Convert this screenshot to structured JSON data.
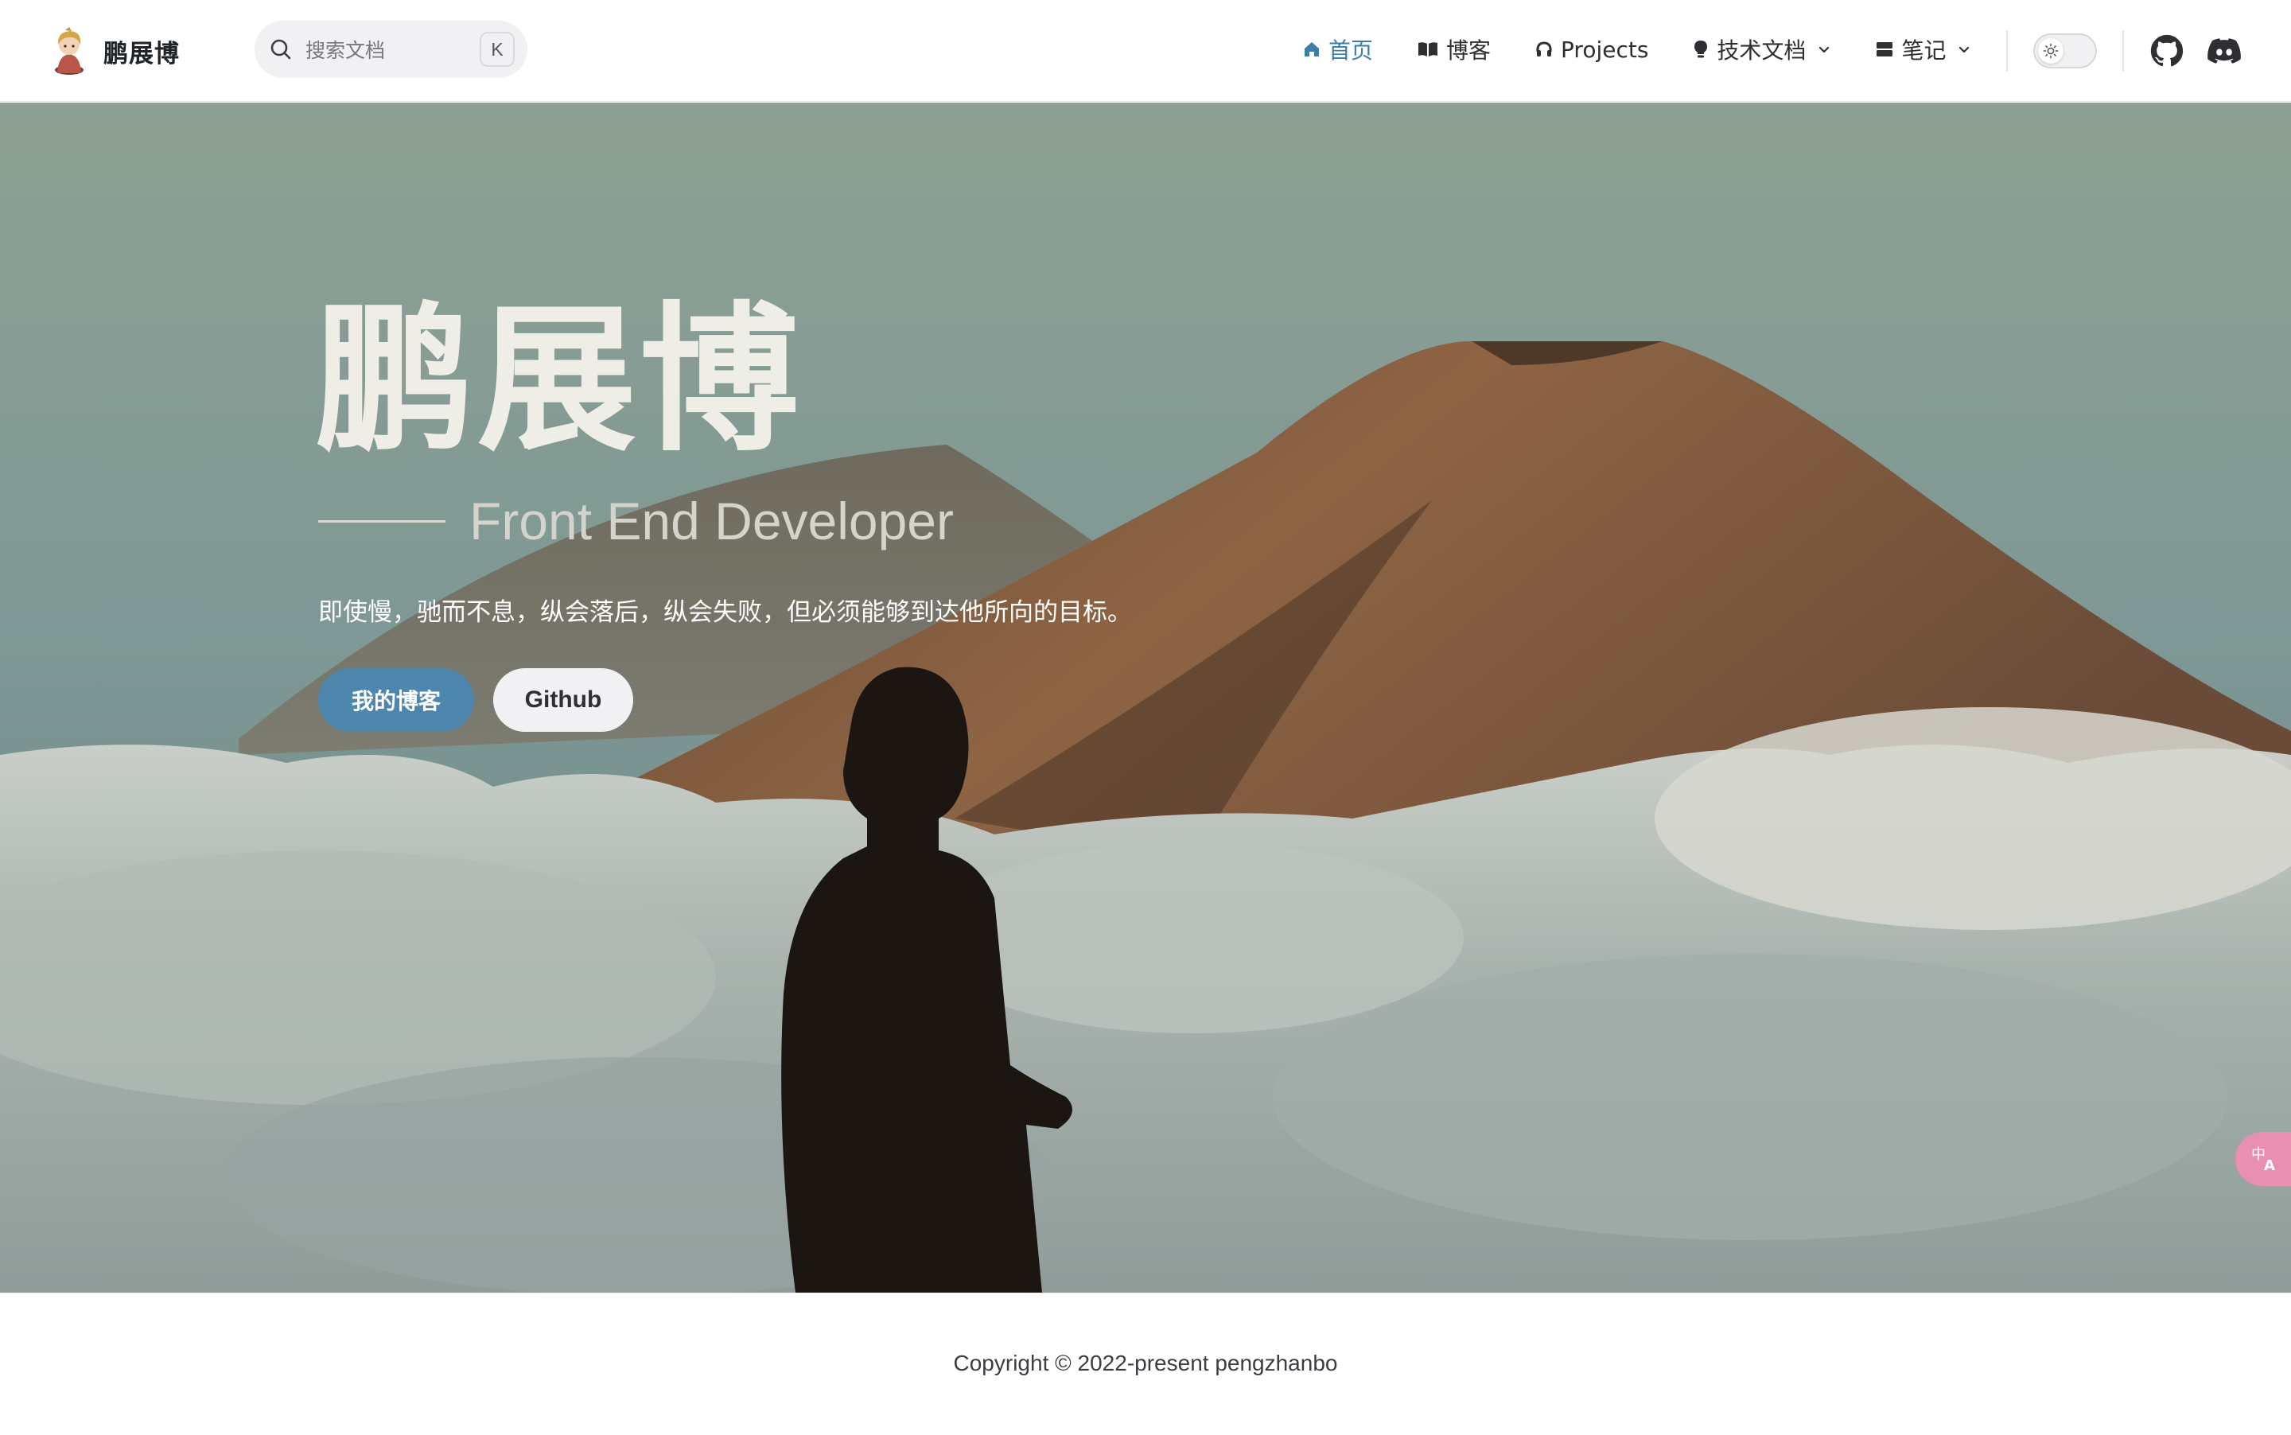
{
  "navbar": {
    "brand_title": "鹏展博",
    "search": {
      "placeholder": "搜索文档",
      "shortcut_key": "K"
    },
    "links": [
      {
        "label": "首页",
        "icon": "home-icon",
        "active": true
      },
      {
        "label": "博客",
        "icon": "book-open-icon",
        "active": false
      },
      {
        "label": "Projects",
        "icon": "headphones-icon",
        "active": false
      },
      {
        "label": "技术文档",
        "icon": "lightbulb-icon",
        "active": false,
        "dropdown": true
      },
      {
        "label": "笔记",
        "icon": "server-icon",
        "active": false,
        "dropdown": true
      }
    ],
    "social": [
      "github-icon",
      "discord-icon"
    ]
  },
  "hero": {
    "name": "鹏展博",
    "role": "Front End Developer",
    "motto": "即使慢，驰而不息，纵会落后，纵会失败，但必须能够到达他所向的目标。",
    "primary_button": "我的博客",
    "secondary_button": "Github"
  },
  "footer": {
    "copyright": "Copyright © 2022-present pengzhanbo"
  },
  "colors": {
    "accent": "#3b7ea8",
    "primary_button_bg": "#4d87ad",
    "translate_fab": "#e98fb1"
  }
}
